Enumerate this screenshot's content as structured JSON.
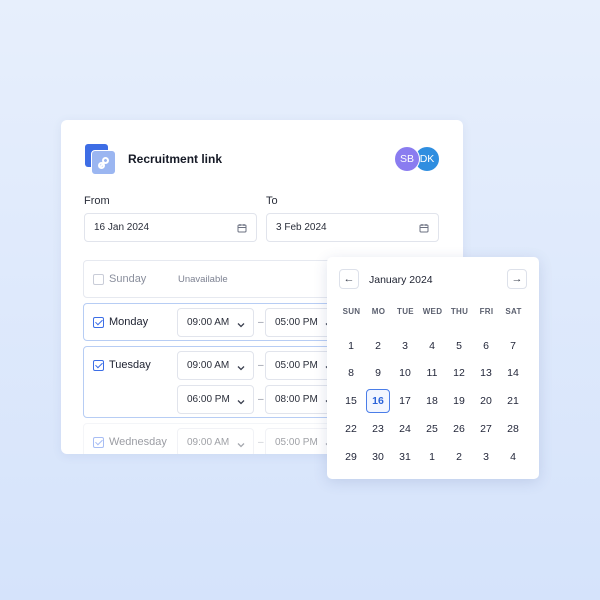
{
  "card": {
    "title": "Recruitment link",
    "avatars": [
      "SB",
      "DK"
    ],
    "from_label": "From",
    "to_label": "To",
    "from_value": "16 Jan 2024",
    "to_value": "3 Feb 2024"
  },
  "days": {
    "sunday": {
      "name": "Sunday",
      "status": "Unavailable",
      "checked": false
    },
    "monday": {
      "name": "Monday",
      "checked": true,
      "start": "09:00 AM",
      "end": "05:00 PM"
    },
    "tuesday": {
      "name": "Tuesday",
      "checked": true,
      "start": "09:00 AM",
      "end": "05:00 PM",
      "start2": "06:00 PM",
      "end2": "08:00 PM"
    },
    "wednesday": {
      "name": "Wednesday",
      "checked": true,
      "start": "09:00 AM",
      "end": "05:00 PM"
    }
  },
  "dash": "–",
  "calendar": {
    "month": "January 2024",
    "prev": "←",
    "next": "→",
    "weekdays": [
      "SUN",
      "MO",
      "TUE",
      "WED",
      "THU",
      "FRI",
      "SAT"
    ],
    "weeks": [
      [
        "1",
        "2",
        "3",
        "4",
        "5",
        "6",
        "7"
      ],
      [
        "8",
        "9",
        "10",
        "11",
        "12",
        "13",
        "14"
      ],
      [
        "15",
        "16",
        "17",
        "18",
        "19",
        "20",
        "21"
      ],
      [
        "22",
        "23",
        "24",
        "25",
        "26",
        "27",
        "28"
      ],
      [
        "29",
        "30",
        "31",
        "1",
        "2",
        "3",
        "4"
      ]
    ],
    "selected": "16"
  },
  "colors": {
    "accent": "#3c6ee6",
    "avatar_sb": "#8a7cf0",
    "avatar_dk": "#2f8ee0"
  }
}
